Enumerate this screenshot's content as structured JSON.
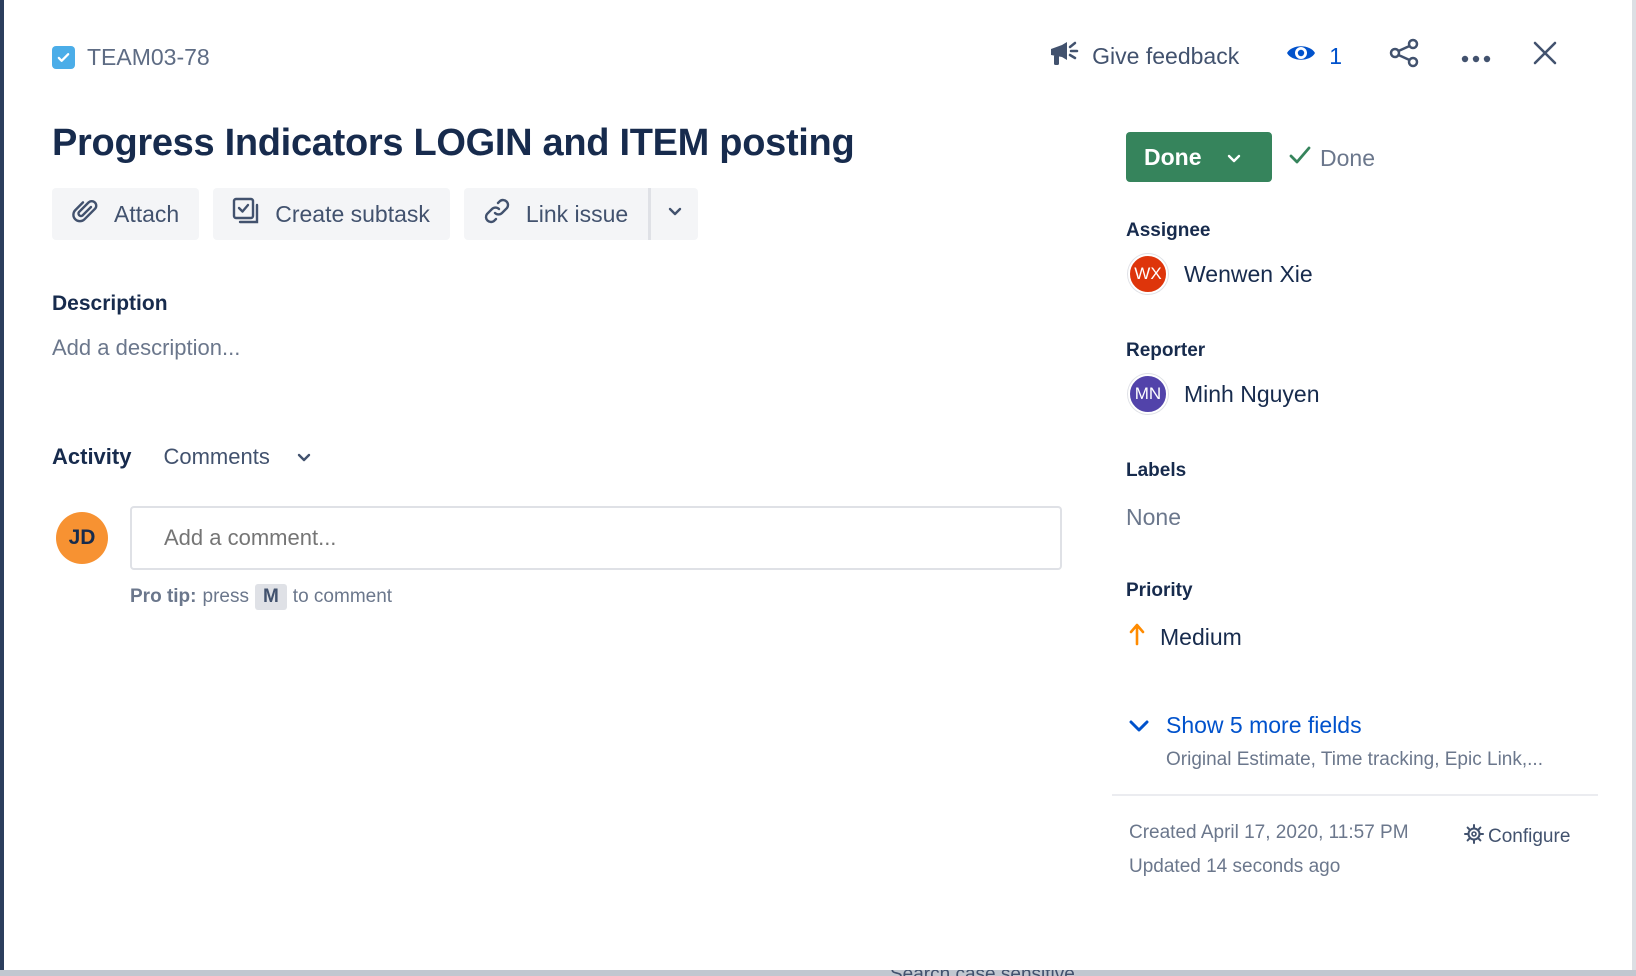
{
  "issue": {
    "key": "TEAM03-78",
    "title": "Progress Indicators LOGIN and ITEM posting"
  },
  "header": {
    "feedback_label": "Give feedback",
    "watch_count": "1"
  },
  "actions": {
    "attach": "Attach",
    "create_subtask": "Create subtask",
    "link_issue": "Link issue"
  },
  "description": {
    "label": "Description",
    "placeholder": "Add a description..."
  },
  "activity": {
    "label": "Activity",
    "filter_selected": "Comments",
    "commenter_initials": "JD",
    "comment_placeholder": "Add a comment...",
    "protip_prefix": "Pro tip:",
    "protip_press": "press",
    "protip_key": "M",
    "protip_suffix": "to comment"
  },
  "status": {
    "label": "Done",
    "resolution": "Done"
  },
  "fields": {
    "assignee_label": "Assignee",
    "assignee_initials": "WX",
    "assignee_name": "Wenwen Xie",
    "reporter_label": "Reporter",
    "reporter_initials": "MN",
    "reporter_name": "Minh Nguyen",
    "labels_label": "Labels",
    "labels_value": "None",
    "priority_label": "Priority",
    "priority_value": "Medium",
    "show_more": "Show 5 more fields",
    "show_more_detail": "Original Estimate, Time tracking, Epic Link,..."
  },
  "meta": {
    "created": "Created April 17, 2020, 11:57 PM",
    "updated": "Updated 14 seconds ago",
    "configure": "Configure"
  },
  "background": {
    "peek_text": "Search case sensitive"
  },
  "colors": {
    "status_done": "#36845c",
    "link_blue": "#0052cc",
    "assignee_avatar": "#de350b",
    "reporter_avatar": "#5243aa",
    "commenter_avatar": "#f79232",
    "priority_medium": "#ff8b00",
    "task_icon": "#4bade8"
  }
}
